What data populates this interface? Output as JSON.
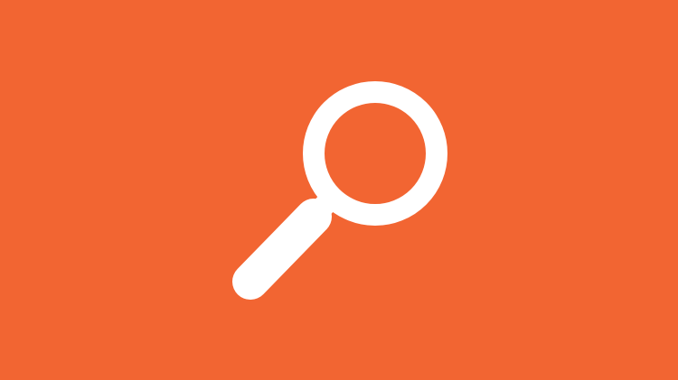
{
  "background": {
    "color": "#F26532"
  },
  "icon": {
    "name": "search-icon",
    "color": "#FFFFFF"
  }
}
